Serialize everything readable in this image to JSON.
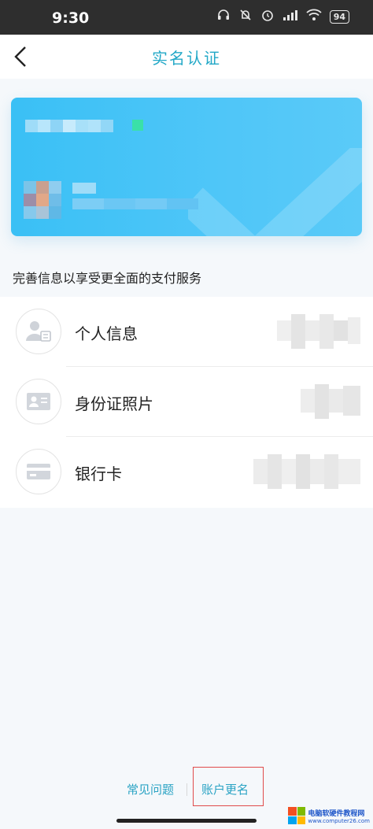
{
  "status_bar": {
    "time": "9:30",
    "icons": [
      "headset-icon",
      "bell-off-icon",
      "alarm-icon",
      "signal-icon",
      "wifi-icon"
    ],
    "battery": "94"
  },
  "nav": {
    "back_icon": "chevron-left-icon",
    "title": "实名认证"
  },
  "card": {
    "icon": "checkmark-icon",
    "colors": {
      "start": "#3ac0f5",
      "end": "#5acaf8"
    }
  },
  "hint": "完善信息以享受更全面的支付服务",
  "list": {
    "items": [
      {
        "label": "个人信息",
        "icon": "person-card-icon"
      },
      {
        "label": "身份证照片",
        "icon": "id-card-icon"
      },
      {
        "label": "银行卡",
        "icon": "bank-card-icon"
      }
    ]
  },
  "footer": {
    "faq": "常见问题",
    "rename": "账户更名"
  },
  "watermark": {
    "title": "电脑软硬件教程网",
    "url": "www.computer26.com"
  },
  "colors": {
    "accent": "#22a8c7",
    "link": "#2aa3c4",
    "highlight": "#e04b4b"
  }
}
